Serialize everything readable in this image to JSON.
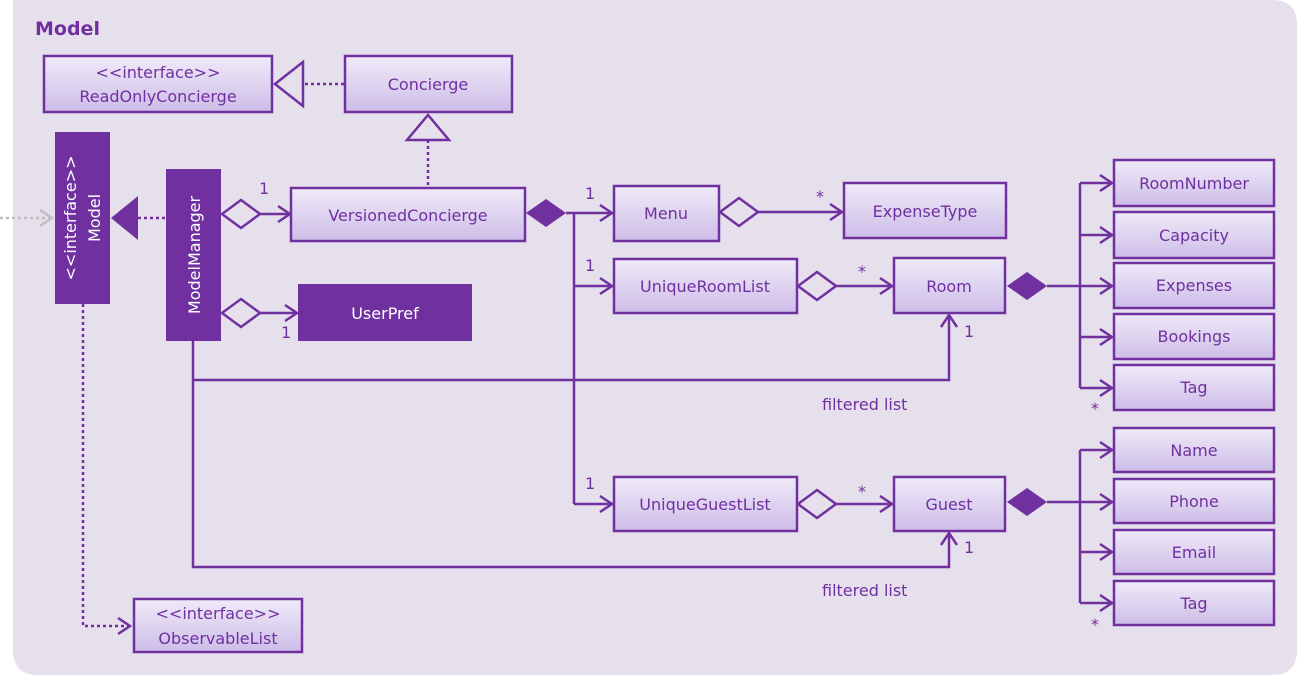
{
  "title": "Model",
  "colors": {
    "accent": "#7030A0",
    "panel_bg": "#E6E0EC",
    "box_light_top": "#F0EAF8",
    "box_light_bottom": "#CDBDE8",
    "external_arrow": "#BFBFBF"
  },
  "nodes": {
    "read_only_concierge": {
      "stereotype": "<<interface>>",
      "name": "ReadOnlyConcierge"
    },
    "concierge": {
      "name": "Concierge"
    },
    "model": {
      "stereotype": "<<interface>>",
      "name": "Model"
    },
    "model_manager": {
      "name": "ModelManager"
    },
    "versioned_concierge": {
      "name": "VersionedConcierge"
    },
    "user_pref": {
      "name": "UserPref"
    },
    "menu": {
      "name": "Menu"
    },
    "expense_type": {
      "name": "ExpenseType"
    },
    "unique_room_list": {
      "name": "UniqueRoomList"
    },
    "room": {
      "name": "Room"
    },
    "unique_guest_list": {
      "name": "UniqueGuestList"
    },
    "guest": {
      "name": "Guest"
    },
    "observable_list": {
      "stereotype": "<<interface>>",
      "name": "ObservableList"
    },
    "room_number": {
      "name": "RoomNumber"
    },
    "capacity": {
      "name": "Capacity"
    },
    "expenses": {
      "name": "Expenses"
    },
    "bookings": {
      "name": "Bookings"
    },
    "room_tag": {
      "name": "Tag"
    },
    "guest_name": {
      "name": "Name"
    },
    "phone": {
      "name": "Phone"
    },
    "email": {
      "name": "Email"
    },
    "guest_tag": {
      "name": "Tag"
    }
  },
  "multiplicities": {
    "mm_versioned": "1",
    "mm_userpref": "1",
    "vc_menu": "1",
    "vc_roomlist": "1",
    "vc_guestlist": "1",
    "menu_expensetype": "*",
    "roomlist_room": "*",
    "guestlist_guest": "*",
    "mm_room": "1",
    "mm_guest": "1",
    "room_attrs": "*",
    "guest_attrs": "*"
  },
  "edge_labels": {
    "room_filtered": "filtered list",
    "guest_filtered": "filtered list"
  }
}
